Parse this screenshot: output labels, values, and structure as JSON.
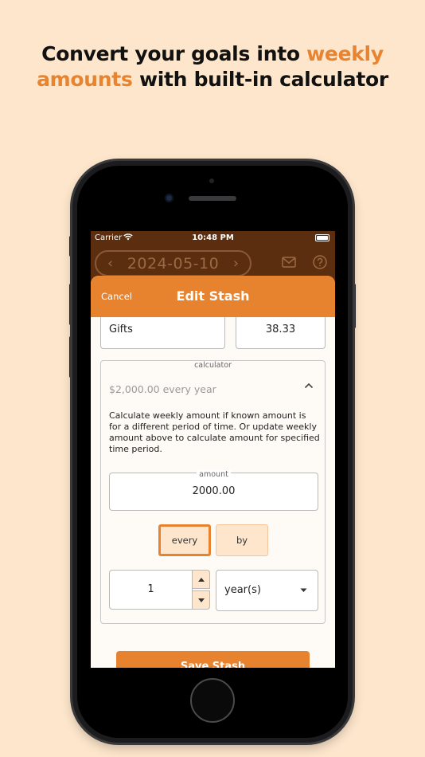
{
  "headline": {
    "line1_prefix": "Convert your goals into ",
    "line1_accent": "weekly",
    "line2_accent": "amounts",
    "line2_suffix": " with built-in calculator"
  },
  "colors": {
    "background": "#fde6cb",
    "accent": "#e7832f",
    "app_header": "#5a2e0e"
  },
  "status_bar": {
    "carrier": "Carrier",
    "time": "10:48 PM",
    "icons": [
      "wifi-icon",
      "battery-icon"
    ]
  },
  "top_bar": {
    "prev": "‹",
    "date": "2024-05-10",
    "next": "›",
    "icons": [
      "mail-icon",
      "help-icon"
    ]
  },
  "sheet": {
    "cancel_label": "Cancel",
    "title": "Edit Stash",
    "name_value": "Gifts",
    "weekly_amount_value": "38.33",
    "calculator": {
      "legend": "calculator",
      "summary": "$2,000.00 every year",
      "description": "Calculate weekly amount if known amount is for a different period of time. Or update weekly amount above to calculate amount for specified time period.",
      "amount_label": "amount",
      "amount_value": "2000.00",
      "mode_options": [
        "every",
        "by"
      ],
      "selected_mode": "every",
      "count_value": "1",
      "period_value": "year(s)"
    },
    "save_label": "Save Stash"
  }
}
